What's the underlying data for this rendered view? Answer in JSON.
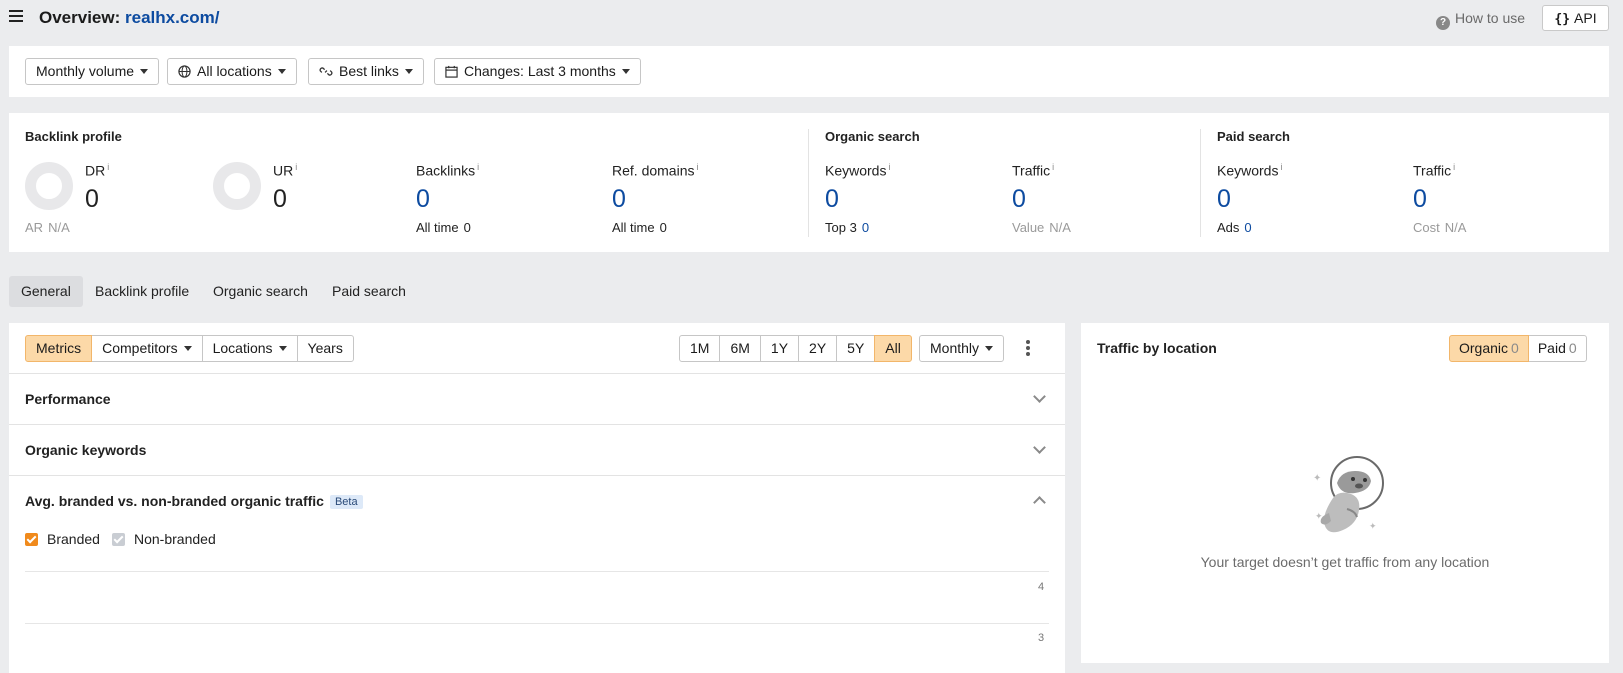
{
  "header": {
    "title_prefix": "Overview:",
    "domain": "realhx.com/",
    "how_to_use": "How to use",
    "api": "API"
  },
  "filters": {
    "volume": "Monthly volume",
    "locations": "All locations",
    "links": "Best links",
    "changes": "Changes: Last 3 months"
  },
  "stats": {
    "backlink_profile": {
      "heading": "Backlink profile",
      "dr": {
        "label": "DR",
        "value": "0",
        "sub_label": "AR",
        "sub_value": "N/A"
      },
      "ur": {
        "label": "UR",
        "value": "0"
      },
      "backlinks": {
        "label": "Backlinks",
        "value": "0",
        "sub_label": "All time",
        "sub_value": "0"
      },
      "ref_domains": {
        "label": "Ref. domains",
        "value": "0",
        "sub_label": "All time",
        "sub_value": "0"
      }
    },
    "organic_search": {
      "heading": "Organic search",
      "keywords": {
        "label": "Keywords",
        "value": "0",
        "sub_label": "Top 3",
        "sub_value": "0"
      },
      "traffic": {
        "label": "Traffic",
        "value": "0",
        "sub_label": "Value",
        "sub_value": "N/A"
      }
    },
    "paid_search": {
      "heading": "Paid search",
      "keywords": {
        "label": "Keywords",
        "value": "0",
        "sub_label": "Ads",
        "sub_value": "0"
      },
      "traffic": {
        "label": "Traffic",
        "value": "0",
        "sub_label": "Cost",
        "sub_value": "N/A"
      }
    },
    "info_mark": "i"
  },
  "tabs": [
    "General",
    "Backlink profile",
    "Organic search",
    "Paid search"
  ],
  "metrics_card": {
    "views": [
      "Metrics",
      "Competitors",
      "Locations",
      "Years"
    ],
    "ranges": [
      "1M",
      "6M",
      "1Y",
      "2Y",
      "5Y",
      "All"
    ],
    "interval": "Monthly",
    "sections": {
      "performance": "Performance",
      "organic_keywords": "Organic keywords",
      "branded": "Avg. branded vs. non-branded organic traffic",
      "beta": "Beta"
    },
    "legend": {
      "branded": "Branded",
      "non_branded": "Non-branded"
    },
    "y_ticks": [
      "4",
      "3"
    ]
  },
  "traffic_by_location": {
    "title": "Traffic by location",
    "organic_label": "Organic",
    "organic_count": "0",
    "paid_label": "Paid",
    "paid_count": "0",
    "empty_message": "Your target doesn’t get traffic from any location"
  },
  "colors": {
    "accent": "#f08a1c",
    "active_segment": "#fcd9a8",
    "link_blue": "#0d4ba0"
  }
}
